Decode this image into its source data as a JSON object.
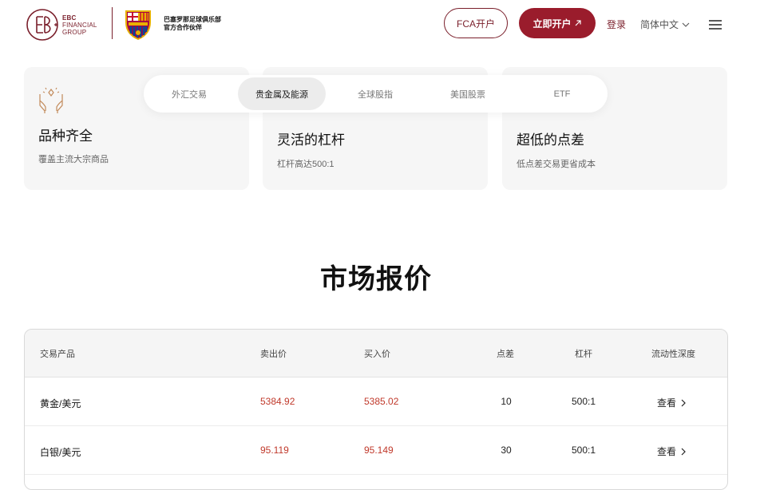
{
  "header": {
    "logo_line1": "EBC",
    "logo_line2": "FINANCIAL",
    "logo_line3": "GROUP",
    "partner_line1": "巴塞罗那足球俱乐部",
    "partner_line2": "官方合作伙伴",
    "fca_button": "FCA开户",
    "open_button": "立即开户",
    "login": "登录",
    "language": "简体中文"
  },
  "features": [
    {
      "title": "品种齐全",
      "desc": "覆盖主流大宗商品"
    },
    {
      "title": "灵活的杠杆",
      "desc": "杠杆高达500:1"
    },
    {
      "title": "超低的点差",
      "desc": "低点差交易更省成本"
    }
  ],
  "tabs": [
    {
      "label": "外汇交易",
      "active": false
    },
    {
      "label": "贵金属及能源",
      "active": true
    },
    {
      "label": "全球股指",
      "active": false
    },
    {
      "label": "美国股票",
      "active": false
    },
    {
      "label": "ETF",
      "active": false
    }
  ],
  "section_title": "市场报价",
  "table": {
    "headers": {
      "product": "交易产品",
      "sell": "卖出价",
      "buy": "买入价",
      "spread": "点差",
      "leverage": "杠杆",
      "depth": "流动性深度"
    },
    "rows": [
      {
        "product": "黄金/美元",
        "sell": "5384.92",
        "buy": "5385.02",
        "spread": "10",
        "leverage": "500:1",
        "depth": "查看"
      },
      {
        "product": "白银/美元",
        "sell": "95.119",
        "buy": "95.149",
        "spread": "30",
        "leverage": "500:1",
        "depth": "查看"
      }
    ]
  },
  "colors": {
    "brand": "#7a1f2b",
    "primary_button": "#9a1c2c",
    "price": "#c0392b"
  }
}
